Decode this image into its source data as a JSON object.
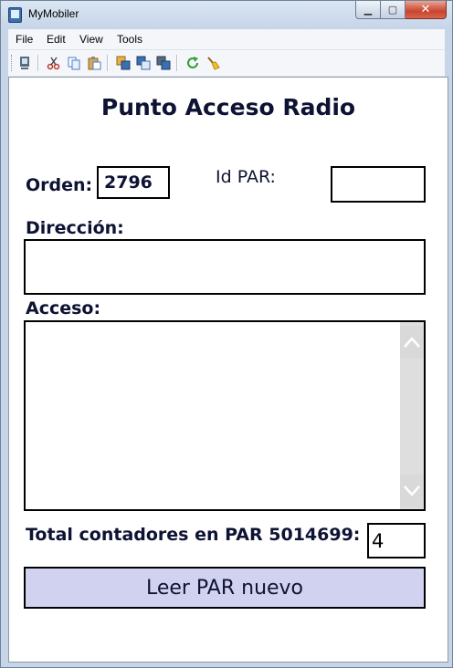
{
  "window": {
    "title": "MyMobiler",
    "minimize": "▁",
    "maximize": "▢",
    "close": "✕"
  },
  "menu": [
    "File",
    "Edit",
    "View",
    "Tools"
  ],
  "toolbar": [
    "device-icon",
    "cut-icon",
    "copy-icon",
    "paste-icon",
    "copy-to-device-icon",
    "copy-from-device-icon",
    "capture-icon",
    "refresh-icon",
    "clean-icon"
  ],
  "form": {
    "title": "Punto Acceso Radio",
    "orden_label": "Orden:",
    "orden_value": "2796",
    "idpar_label": "Id PAR:",
    "idpar_value": "",
    "direccion_label": "Dirección:",
    "direccion_value": "",
    "acceso_label": "Acceso:",
    "acceso_value": "",
    "total_label": "Total contadores en PAR 5014699:",
    "total_value": "4",
    "read_button": "Leer PAR nuevo"
  },
  "colors": {
    "button_bg": "#d1d2f0",
    "text": "#0e1233"
  }
}
